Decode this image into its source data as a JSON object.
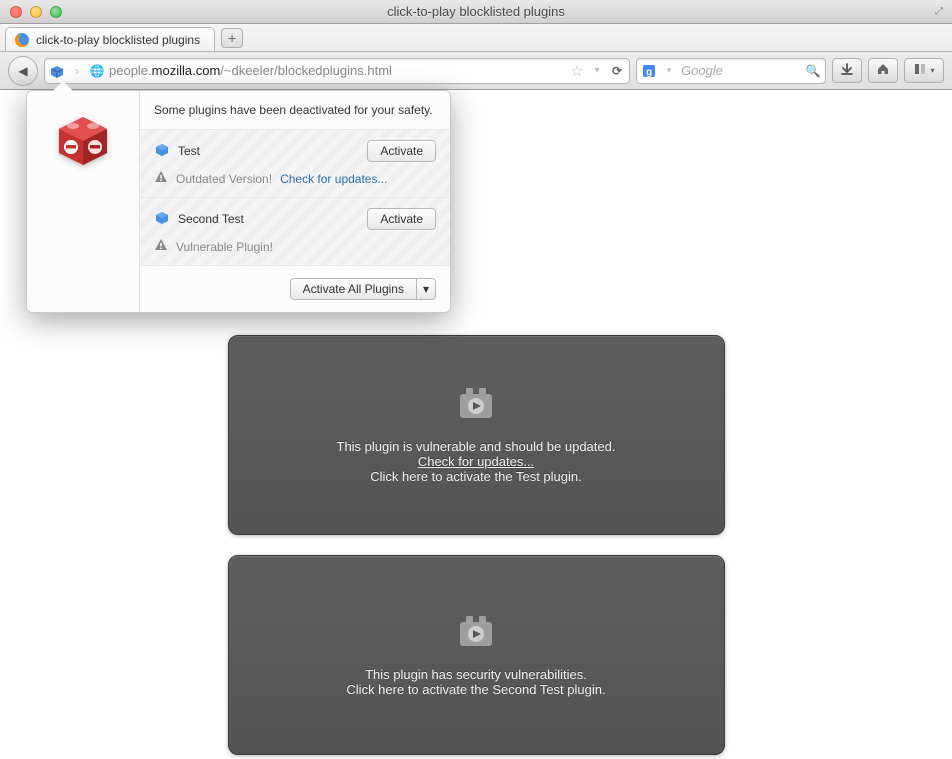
{
  "window": {
    "title": "click-to-play blocklisted plugins"
  },
  "tab": {
    "title": "click-to-play blocklisted plugins"
  },
  "urlbar": {
    "prefix": "people.",
    "domain": "mozilla.com",
    "path": "/~dkeeler/blockedplugins.html"
  },
  "searchbar": {
    "placeholder": "Google"
  },
  "popover": {
    "header": "Some plugins have been deactivated for your safety.",
    "plugins": [
      {
        "name": "Test",
        "activate_label": "Activate",
        "warning": "Outdated Version!",
        "check_link": "Check for updates..."
      },
      {
        "name": "Second Test",
        "activate_label": "Activate",
        "warning": "Vulnerable Plugin!",
        "check_link": ""
      }
    ],
    "activate_all_label": "Activate All Plugins",
    "dropdown_glyph": "▾"
  },
  "content_blocks": [
    {
      "line1": "This plugin is vulnerable and should be updated.",
      "link": "Check for updates...",
      "line2": "Click here to activate the Test plugin."
    },
    {
      "line1": "This plugin has security vulnerabilities.",
      "link": "",
      "line2": "Click here to activate the Second Test plugin."
    }
  ],
  "glyphs": {
    "back": "◀",
    "forward": "▶",
    "star": "☆",
    "reload": "⟳",
    "search": "🔍",
    "download": "⬇",
    "home": "⌂",
    "bookmarks": "◧",
    "plus": "+",
    "dropdown": "▾",
    "warn": "▲"
  }
}
